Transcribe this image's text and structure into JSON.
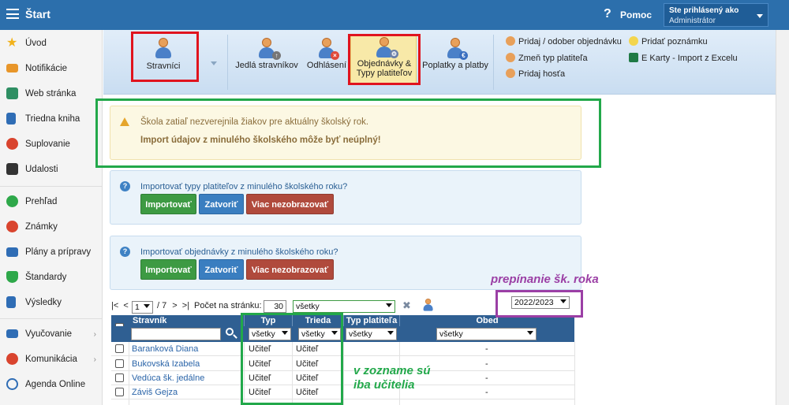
{
  "topbar": {
    "title": "Štart",
    "help": "Pomoc",
    "user_line1": "Ste prihlásený ako",
    "user_line2": "Administrátor"
  },
  "sidebar": {
    "items": [
      {
        "label": "Úvod",
        "color": "#f2b21b"
      },
      {
        "label": "Notifikácie",
        "color": "#e8962a"
      },
      {
        "label": "Web stránka",
        "color": "#2f8f63"
      },
      {
        "label": "Triedna kniha",
        "color": "#2f6db5"
      },
      {
        "label": "Suplovanie",
        "color": "#d9442e"
      },
      {
        "label": "Udalosti",
        "color": "#333333"
      },
      {
        "label": "Prehľad",
        "color": "#2ea84a"
      },
      {
        "label": "Známky",
        "color": "#d9442e"
      },
      {
        "label": "Plány a prípravy",
        "color": "#2f6db5"
      },
      {
        "label": "Štandardy",
        "color": "#2ea84a"
      },
      {
        "label": "Výsledky",
        "color": "#2f6db5"
      },
      {
        "label": "Vyučovanie",
        "color": "#2f6db5"
      },
      {
        "label": "Komunikácia",
        "color": "#d9442e"
      },
      {
        "label": "Agenda Online",
        "color": "#2f6db5"
      }
    ]
  },
  "ribbon": {
    "stravnici": "Stravníci",
    "jedla": "Jedlá stravníkov",
    "odhlasenia": "Odhlásení",
    "objednavky_l1": "Objednávky &",
    "objednavky_l2": "Typy platiteľov",
    "poplatky": "Poplatky a platby",
    "links": {
      "pridaj_odober": "Pridaj / odober objednávku",
      "zmen_typ": "Zmeň typ platiteľa",
      "pridaj_hosta": "Pridaj hosťa",
      "pridat_poznamku": "Pridať poznámku",
      "ekarty": "E Karty - Import z Excelu"
    }
  },
  "warning": {
    "line1": "Škola zatiaľ nezverejnila žiakov pre aktuálny školský rok.",
    "line2": "Import údajov z minulého školského môže byť neúplný!"
  },
  "info1": {
    "text": "Importovať typy platiteľov z minulého školského roku?",
    "import": "Importovať",
    "close": "Zatvoriť",
    "hide": "Viac nezobrazovať"
  },
  "info2": {
    "text": "Importovať objednávky z minulého školského roku?",
    "import": "Importovať",
    "close": "Zatvoriť",
    "hide": "Viac nezobrazovať"
  },
  "annotations": {
    "year_switch": "prepínanie šk. roka",
    "teachers_line1": "v zozname sú",
    "teachers_line2": "iba učitelia"
  },
  "pager": {
    "first": "|<",
    "prev": "<",
    "page": "1",
    "total": "/ 7",
    "next": ">",
    "last": ">|",
    "per_page_label": "Počet na stránku:",
    "per_page": "30",
    "filter": "všetky",
    "school_year": "2022/2023"
  },
  "table": {
    "headers": {
      "stravnik": "Stravník",
      "typ": "Typ",
      "trieda": "Trieda",
      "typ_platitela": "Typ platiteľa",
      "obed": "Obed"
    },
    "filters": {
      "typ": "všetky",
      "trieda": "všetky",
      "typ_platitela": "všetky",
      "obed": "všetky"
    },
    "rows": [
      {
        "name": "Baranková Diana",
        "typ": "Učiteľ",
        "trieda": "Učiteľ",
        "obed": "-"
      },
      {
        "name": "Bukovská Izabela",
        "typ": "Učiteľ",
        "trieda": "Učiteľ",
        "obed": "-"
      },
      {
        "name": "Vedúca šk. jedálne",
        "typ": "Učiteľ",
        "trieda": "Učiteľ",
        "obed": "-"
      },
      {
        "name": "Záviš Gejza",
        "typ": "Učiteľ",
        "trieda": "Učiteľ",
        "obed": "-"
      }
    ]
  }
}
